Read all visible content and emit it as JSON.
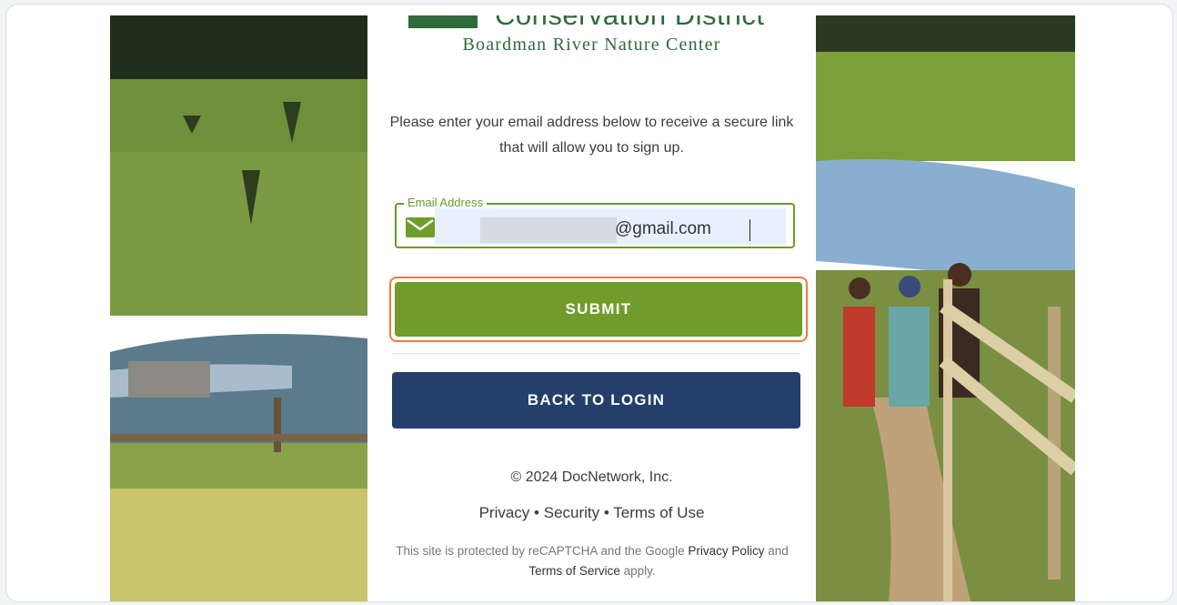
{
  "logo": {
    "title": "Conservation District",
    "subtitle": "Boardman River Nature Center"
  },
  "intro": "Please enter your email address below to receive a secure link that will allow you to sign up.",
  "email": {
    "label": "Email Address",
    "value": "@gmail.com",
    "icon": "envelope-icon"
  },
  "buttons": {
    "submit": "SUBMIT",
    "back": "BACK TO LOGIN"
  },
  "footer": {
    "copyright": "© 2024 DocNetwork, Inc.",
    "privacy": "Privacy",
    "security": "Security",
    "terms": "Terms of Use",
    "separator": "•",
    "recaptcha_prefix": "This site is protected by reCAPTCHA and the Google",
    "recaptcha_privacy": "Privacy Policy",
    "recaptcha_and": "and",
    "recaptcha_terms": "Terms of Service",
    "recaptcha_suffix": "apply."
  },
  "colors": {
    "accent_green": "#6f9c2b",
    "navy": "#243f6b",
    "focus_orange": "#f07b3f"
  }
}
